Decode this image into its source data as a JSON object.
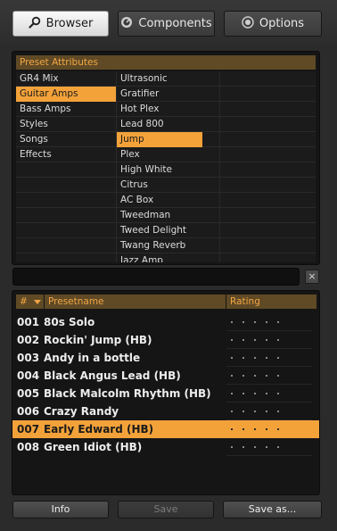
{
  "tabs": [
    {
      "label": "Browser",
      "icon": "search-icon",
      "active": true
    },
    {
      "label": "Components",
      "icon": "gauge-icon",
      "active": false
    },
    {
      "label": "Options",
      "icon": "radio-icon",
      "active": false
    }
  ],
  "attributes": {
    "header": "Preset Attributes",
    "categories": [
      "GR4 Mix",
      "Guitar Amps",
      "Bass Amps",
      "Styles",
      "Songs",
      "Effects"
    ],
    "selected_category": "Guitar Amps",
    "values": [
      "Ultrasonic",
      "Gratifier",
      "Hot Plex",
      "Lead 800",
      "Jump",
      "Plex",
      "High White",
      "Citrus",
      "AC Box",
      "Tweedman",
      "Tweed Delight",
      "Twang Reverb",
      "Jazz Amp"
    ],
    "selected_value": "Jump"
  },
  "search": {
    "value": "",
    "clear_label": "×"
  },
  "presets": {
    "col_num": "#",
    "col_name": "Presetname",
    "col_rating": "Rating",
    "rows": [
      {
        "num": "001",
        "name": "80s Solo"
      },
      {
        "num": "002",
        "name": "Rockin' Jump (HB)"
      },
      {
        "num": "003",
        "name": "Andy in a bottle"
      },
      {
        "num": "004",
        "name": "Black Angus Lead (HB)"
      },
      {
        "num": "005",
        "name": "Black Malcolm Rhythm (HB)"
      },
      {
        "num": "006",
        "name": "Crazy Randy"
      },
      {
        "num": "007",
        "name": "Early Edward (HB)"
      },
      {
        "num": "008",
        "name": "Green Idiot (HB)"
      }
    ],
    "selected_num": "007",
    "rating_max": 5
  },
  "buttons": {
    "info": "Info",
    "save": "Save",
    "save_as": "Save as..."
  },
  "colors": {
    "accent": "#f3a23a",
    "header_bg": "#5f4a25",
    "header_text": "#f3a545"
  }
}
